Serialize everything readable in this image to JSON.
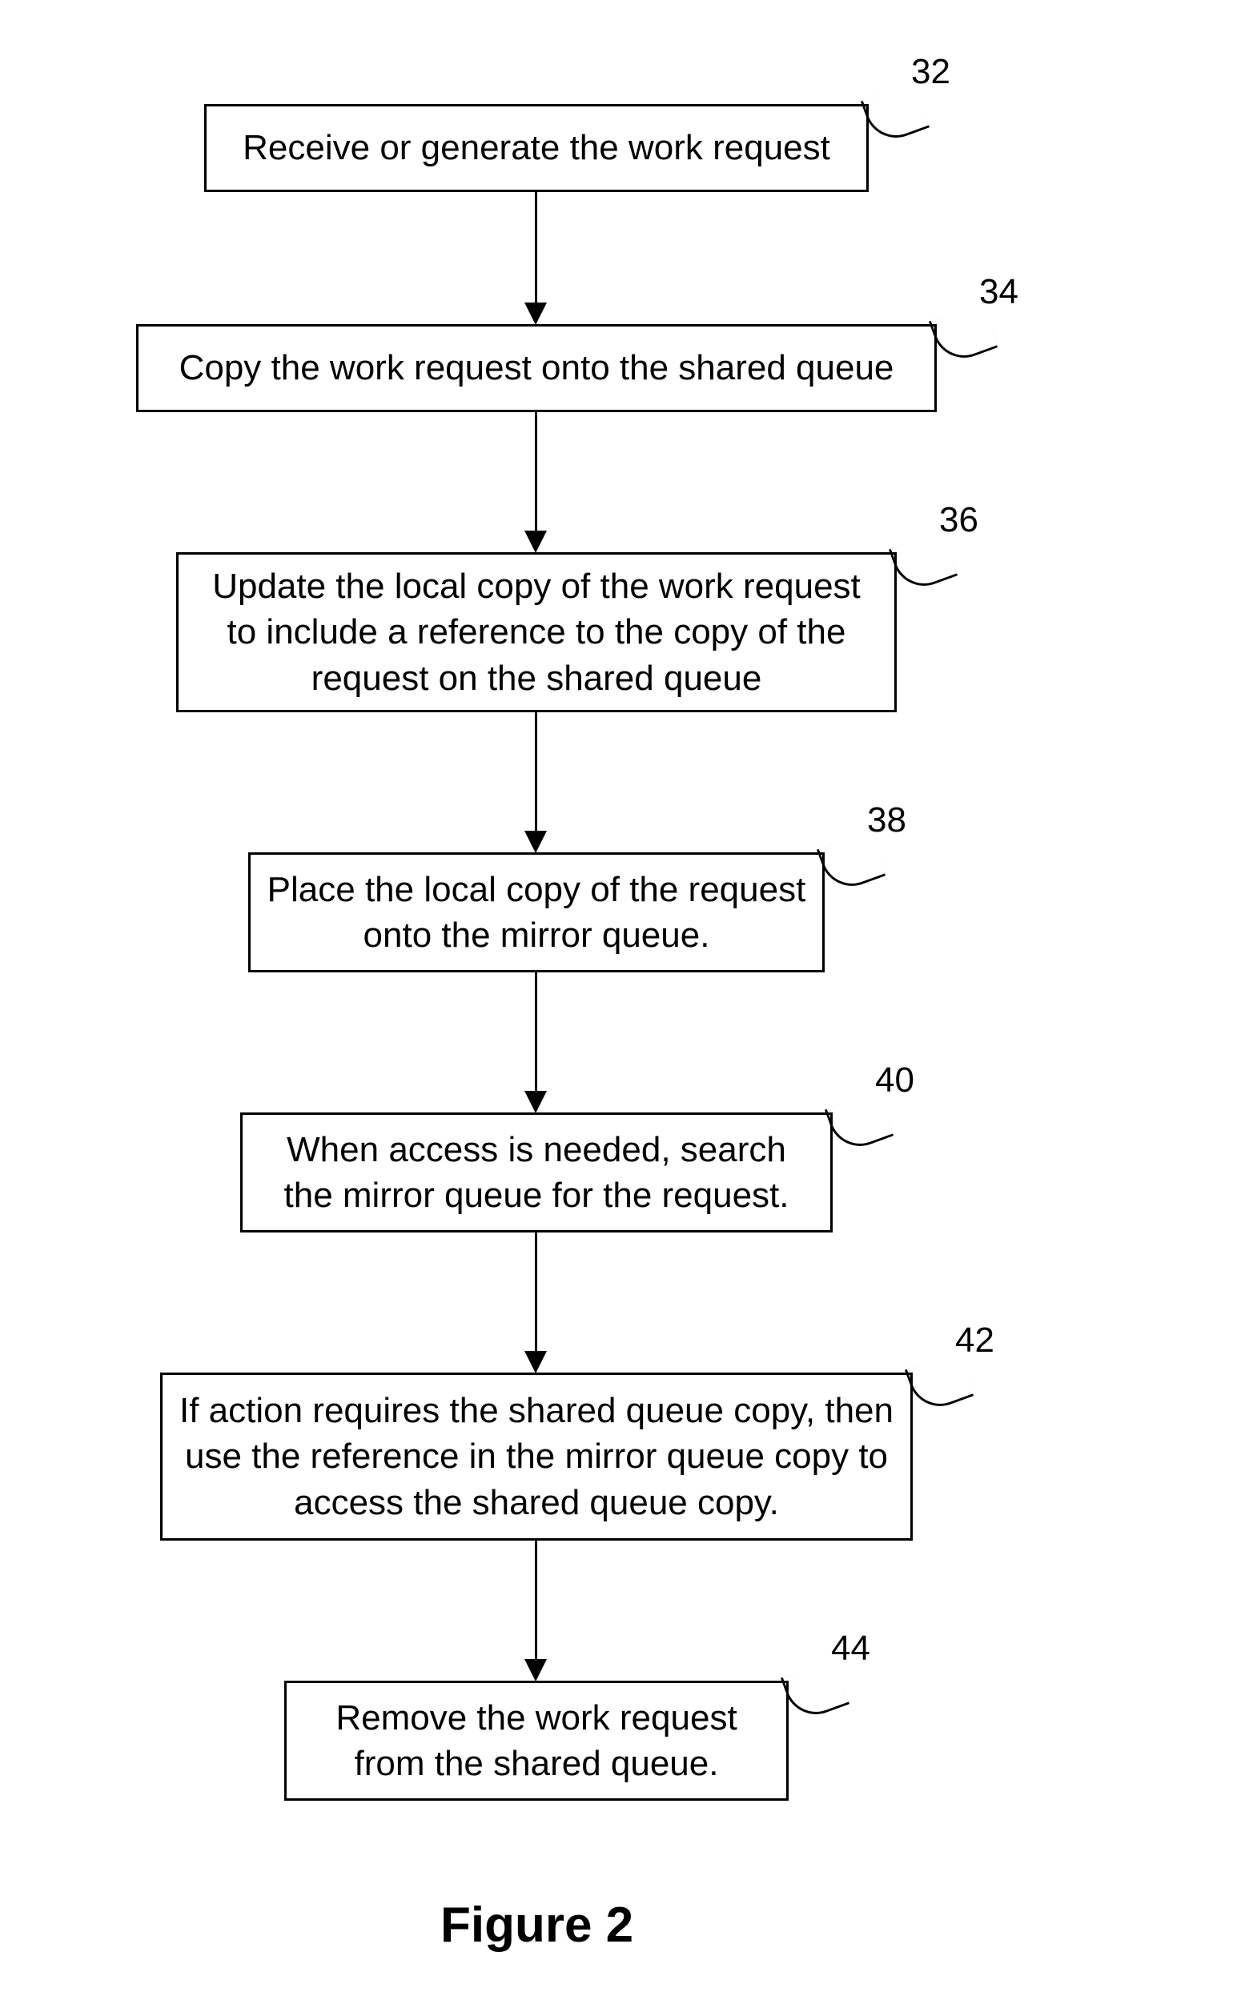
{
  "figure_title": "Figure 2",
  "steps": [
    {
      "num": "32",
      "text": "Receive or generate the work request"
    },
    {
      "num": "34",
      "text": "Copy the work request onto the shared queue"
    },
    {
      "num": "36",
      "text": "Update the local copy of the work request to include a reference to the copy of the request on the shared queue"
    },
    {
      "num": "38",
      "text": "Place the local copy of the request onto the mirror queue."
    },
    {
      "num": "40",
      "text": "When access is needed, search the mirror queue for the request."
    },
    {
      "num": "42",
      "text": "If action requires the shared queue copy, then use the reference in the mirror queue copy to access the shared queue copy."
    },
    {
      "num": "44",
      "text": "Remove the work request from the shared queue."
    }
  ]
}
